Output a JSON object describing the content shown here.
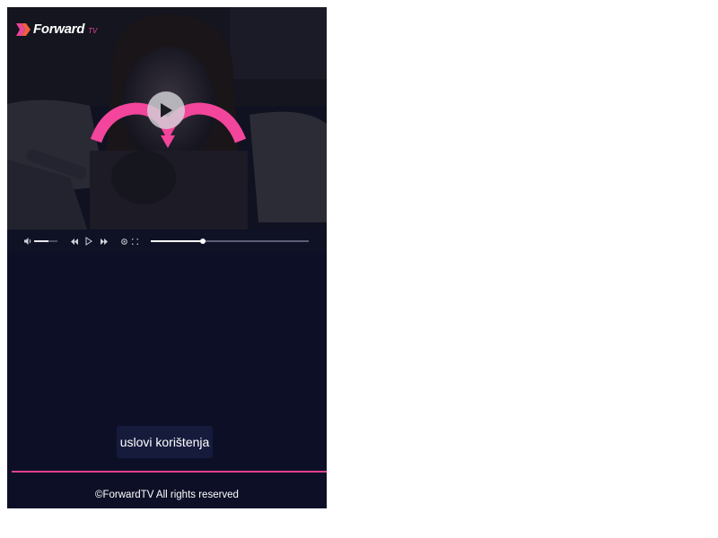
{
  "brand": {
    "name": "Forward",
    "suffix": "TV",
    "accent": "#e8459a"
  },
  "video": {
    "overlay_icon": "play-icon",
    "watermark": "pink-m-logo",
    "progress": 0.33,
    "volume": 0.6,
    "controls": [
      "volume-icon",
      "rewind-icon",
      "play-icon",
      "fast-forward-icon",
      "settings-icon",
      "fullscreen-icon"
    ]
  },
  "footer": {
    "terms_label": "uslovi korištenja",
    "copyright": "©ForwardTV All rights reserved"
  },
  "colors": {
    "background": "#0c0f26",
    "button": "#161b3c",
    "footer_line": "#e0408e"
  }
}
